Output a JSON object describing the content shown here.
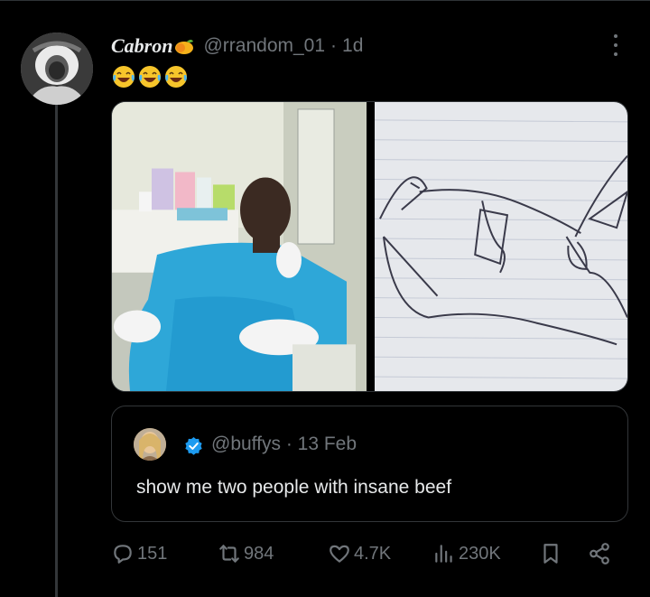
{
  "post": {
    "author_name": "Cabron",
    "author_handle": "@rrandom_01",
    "separator": "·",
    "time": "1d",
    "name_emoji": "mango-icon",
    "body_emojis": [
      "face-with-tears-of-joy-icon",
      "face-with-tears-of-joy-icon",
      "face-with-tears-of-joy-icon"
    ]
  },
  "quote": {
    "handle": "@buffys",
    "separator": "·",
    "date": "13 Feb",
    "text": "show me two people with insane beef",
    "verified": true
  },
  "actions": {
    "replies": "151",
    "reposts": "984",
    "likes": "4.7K",
    "views": "230K"
  },
  "colors": {
    "background": "#000000",
    "text": "#e7e9ea",
    "secondary": "#71767b",
    "border": "#2f3336",
    "verified": "#1d9bf0"
  }
}
